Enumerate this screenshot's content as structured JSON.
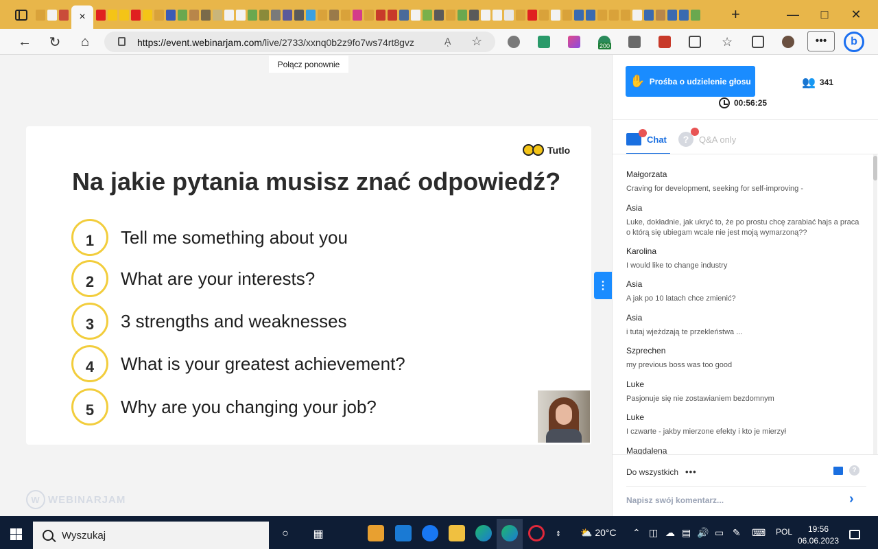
{
  "browser": {
    "url_domain": "https://event.webinarjam.com",
    "url_path": "/live/2733/xxnq0b2z9fo7ws74rt8gvz",
    "read_aloud_label": "Aͅ",
    "extension_badge": "200",
    "tab_close": "×",
    "new_tab": "+"
  },
  "page": {
    "reconnect_label": "Połącz ponownie",
    "watermark": "WEBINARJAM"
  },
  "slide": {
    "brand": "Tutlo",
    "title": "Na jakie pytania musisz znać odpowiedź?",
    "questions": [
      {
        "num": "1",
        "text": "Tell me something about you"
      },
      {
        "num": "2",
        "text": "What are your interests?"
      },
      {
        "num": "3",
        "text": "3 strengths and weaknesses"
      },
      {
        "num": "4",
        "text": "What is your greatest achievement?"
      },
      {
        "num": "5",
        "text": "Why are you changing your job?"
      }
    ]
  },
  "panel": {
    "raise_hand_label": "Prośba o udzielenie głosu",
    "attendee_count": "341",
    "timer": "00:56:25",
    "tabs": [
      {
        "label": "Chat",
        "active": true
      },
      {
        "label": "Q&A only",
        "active": false
      }
    ],
    "messages": [
      {
        "name": "Małgorzata",
        "text": "Craving for development, seeking for self-improving -"
      },
      {
        "name": "Asia",
        "text": "Luke, dokładnie, jak ukryć to, że po prostu chcę zarabiać hajs a praca o którą się ubiegam wcale nie jest moją wymarzoną??"
      },
      {
        "name": "Karolina",
        "text": "I would like to change industry"
      },
      {
        "name": "Asia",
        "text": "A jak po 10 latach chce zmienić?"
      },
      {
        "name": "Asia",
        "text": "i tutaj wjeżdzają te przekleństwa ..."
      },
      {
        "name": "Szprechen",
        "text": "my previous boss was too good"
      },
      {
        "name": "Luke",
        "text": "Pasjonuje się nie zostawianiem bezdomnym"
      },
      {
        "name": "Luke",
        "text": "I czwarte - jakby mierzone efekty i kto je mierzył"
      },
      {
        "name": "Magdalena",
        "text": ""
      }
    ],
    "recipient_label": "Do wszystkich",
    "comment_placeholder": "Napisz swój komentarz..."
  },
  "taskbar": {
    "search_placeholder": "Wyszukaj",
    "weather": "20°C",
    "language": "POL",
    "time": "19:56",
    "date": "06.06.2023"
  },
  "colors": {
    "accent_blue": "#1a8cff",
    "tab_bar": "#e8b64a",
    "question_ring": "#f2cd3c",
    "notification_dot": "#e85454"
  }
}
